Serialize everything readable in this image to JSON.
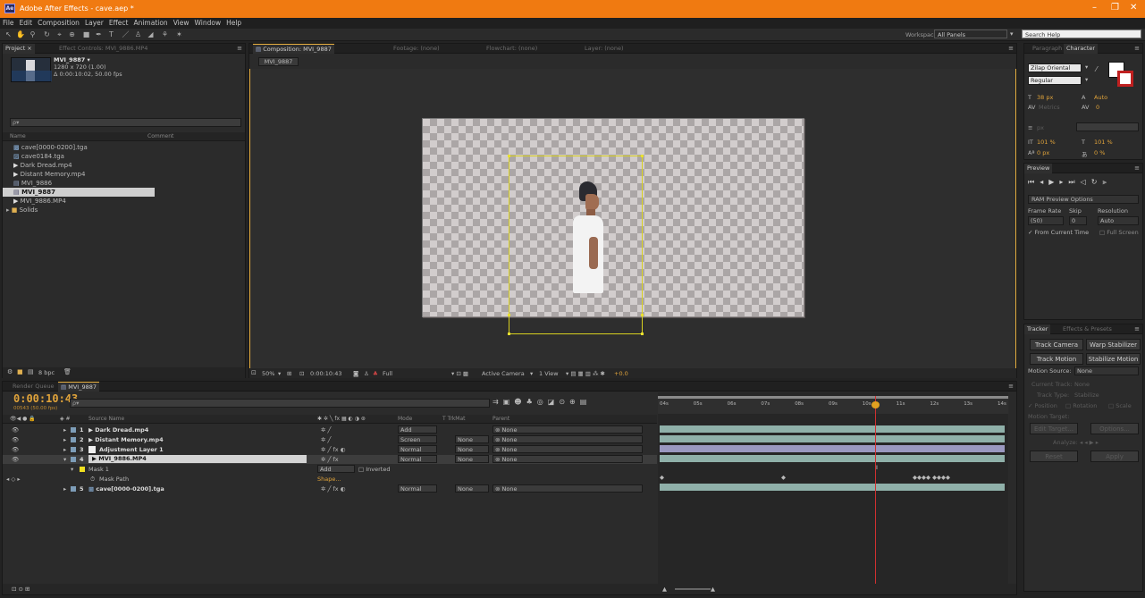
{
  "window": {
    "title": "Adobe After Effects - cave.aep *",
    "app_icon": "Ae",
    "min": "–",
    "max": "❐",
    "close": "✕"
  },
  "menu": [
    "File",
    "Edit",
    "Composition",
    "Layer",
    "Effect",
    "Animation",
    "View",
    "Window",
    "Help"
  ],
  "toolbar": {
    "workspace_label": "Workspace:",
    "workspace_value": "All Panels",
    "search_placeholder": "Search Help"
  },
  "project": {
    "tab_project": "Project ×",
    "tab_effect_controls": "Effect Controls: MVI_9886.MP4",
    "item_name": "MVI_9887 ▾",
    "item_size": "1280 x 720 (1.00)",
    "item_duration": "Δ 0:00:10:02, 50.00 fps",
    "search_placeholder": "ρ▾",
    "col_name": "Name",
    "col_comment": "Comment",
    "items": [
      "cave[0000-0200].tga",
      "cave0184.tga",
      "Dark Dread.mp4",
      "Distant Memory.mp4",
      "MVI_9886",
      "MVI_9887",
      "MVI_9886.MP4",
      "Solids"
    ],
    "footer_bpc": "8 bpc"
  },
  "composition": {
    "tab_comp": "Composition: MVI_9887",
    "tab_footage": "Footage: (none)",
    "tab_flowchart": "Flowchart: (none)",
    "tab_layer": "Layer: (none)",
    "comp_tab_button": "MVI_9887",
    "zoom": "50%",
    "timecode": "0:00:10:43",
    "resolution": "Full",
    "camera": "Active Camera",
    "views": "1 View",
    "exposure": "+0.0"
  },
  "character": {
    "tab_paragraph": "Paragraph",
    "tab_character": "Character",
    "font": "Zilap Oriental",
    "style": "Regular",
    "size": "38 px",
    "leading": "Auto",
    "kerning": "Metrics",
    "tracking": "0",
    "stroke_unit": "px",
    "vscale": "101 %",
    "hscale": "101 %",
    "baseline": "0 px",
    "tsume": "0 %"
  },
  "preview": {
    "tab": "Preview",
    "ram_options": "RAM Preview Options",
    "frame_rate_label": "Frame Rate",
    "skip_label": "Skip",
    "resolution_label": "Resolution",
    "frame_rate": "(50)",
    "skip": "0",
    "resolution": "Auto",
    "from_current": "From Current Time",
    "full_screen": "Full Screen"
  },
  "tracker": {
    "tab_tracker": "Tracker",
    "tab_effects": "Effects & Presets",
    "track_camera": "Track Camera",
    "warp_stabilizer": "Warp Stabilizer",
    "track_motion": "Track Motion",
    "stabilize_motion": "Stabilize Motion",
    "motion_source_label": "Motion Source:",
    "motion_source": "None",
    "current_track_label": "Current Track:",
    "current_track": "None",
    "track_type_label": "Track Type:",
    "track_type": "Stabilize",
    "position": "Position",
    "rotation": "Rotation",
    "scale": "Scale",
    "motion_target": "Motion Target:",
    "edit_target": "Edit Target...",
    "options": "Options...",
    "analyze_label": "Analyze:",
    "reset": "Reset",
    "apply": "Apply"
  },
  "timeline": {
    "tab_render": "Render Queue",
    "tab_comp": "MVI_9887",
    "timecode": "0:00:10:43",
    "frame_info": "00543 (50.00 fps)",
    "search_placeholder": "ρ▾",
    "col_source": "Source Name",
    "col_mode": "Mode",
    "col_trkmat": "T  TrkMat",
    "col_parent": "Parent",
    "ruler": [
      "04s",
      "05s",
      "06s",
      "07s",
      "08s",
      "09s",
      "10s",
      "11s",
      "12s",
      "13s",
      "14s"
    ],
    "layers": [
      {
        "num": "1",
        "name": "Dark Dread.mp4",
        "mode": "Add",
        "trkmat": "",
        "parent": "None",
        "color": "#7d9db8",
        "bar": "#8fb0a9"
      },
      {
        "num": "2",
        "name": "Distant Memory.mp4",
        "mode": "Screen",
        "trkmat": "None",
        "parent": "None",
        "color": "#7d9db8",
        "bar": "#8fb0a9"
      },
      {
        "num": "3",
        "name": "Adjustment Layer 1",
        "mode": "Normal",
        "trkmat": "None",
        "parent": "None",
        "color": "#e8e8e8",
        "bar": "#9a98c0"
      },
      {
        "num": "4",
        "name": "MVI_9886.MP4",
        "mode": "Normal",
        "trkmat": "None",
        "parent": "None",
        "color": "#7d9db8",
        "bar": "#8fb0a9"
      }
    ],
    "mask": {
      "name": "Mask 1",
      "mode": "Add",
      "inverted": "Inverted",
      "path_label": "Mask Path",
      "path_value": "Shape..."
    },
    "layer5": {
      "num": "5",
      "name": "cave[0000-0200].tga",
      "mode": "Normal",
      "trkmat": "None",
      "parent": "None",
      "bar": "#8fb0a9"
    },
    "playhead_fraction": 0.62
  },
  "colors": {
    "accent": "#f07a11",
    "timecode": "#e0a33a",
    "playhead": "#d03030"
  }
}
